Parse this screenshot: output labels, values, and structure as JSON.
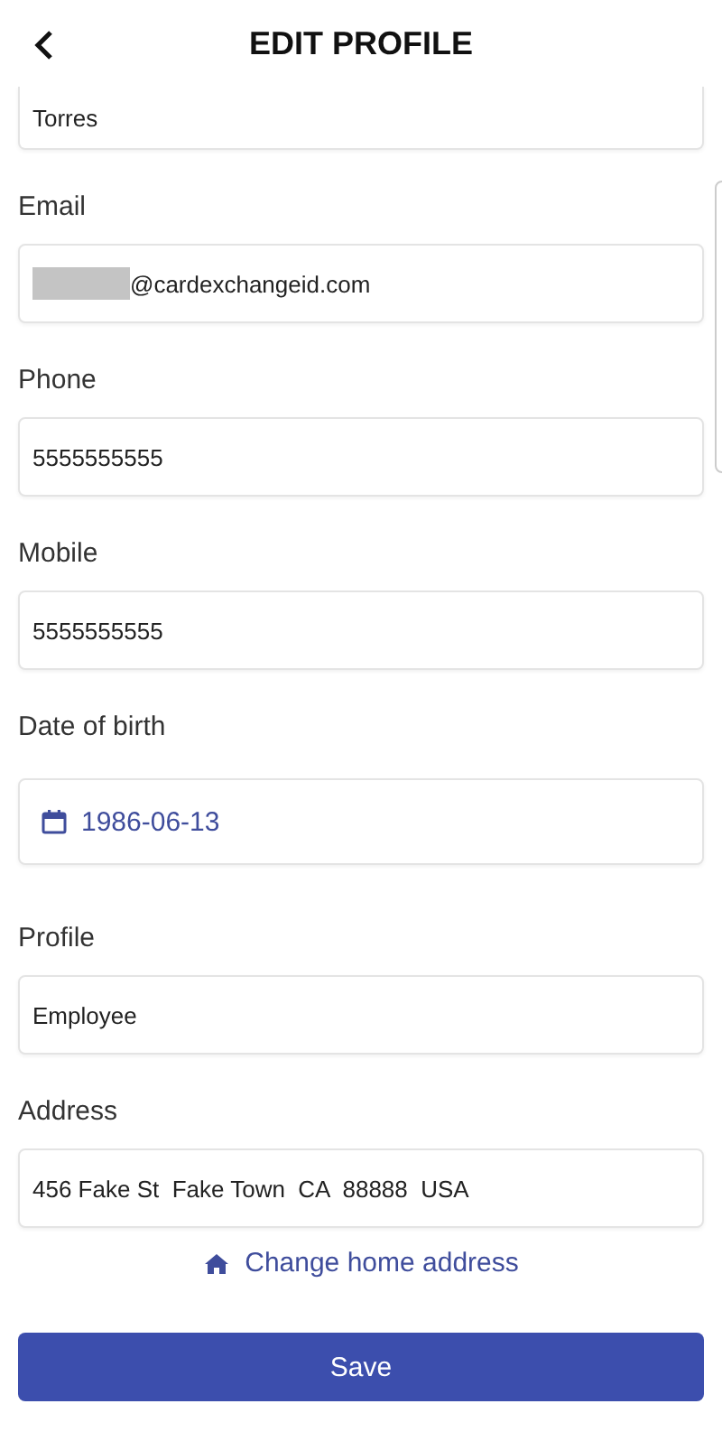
{
  "header": {
    "title": "EDIT PROFILE"
  },
  "fields": [
    {
      "kind": "text",
      "value": "Torres",
      "cut": true
    },
    {
      "kind": "text",
      "label": "Email",
      "value": "@cardexchangeid.com",
      "redacted": true
    },
    {
      "kind": "text",
      "label": "Phone",
      "value": "5555555555"
    },
    {
      "kind": "text",
      "label": "Mobile",
      "value": "5555555555"
    },
    {
      "kind": "date",
      "label": "Date of birth",
      "value": "1986-06-13"
    },
    {
      "kind": "text",
      "label": "Profile",
      "value": "Employee"
    },
    {
      "kind": "text",
      "label": "Address",
      "value": "456 Fake St  Fake Town  CA  88888  USA"
    }
  ],
  "address_link": "Change home address",
  "save_button": "Save"
}
